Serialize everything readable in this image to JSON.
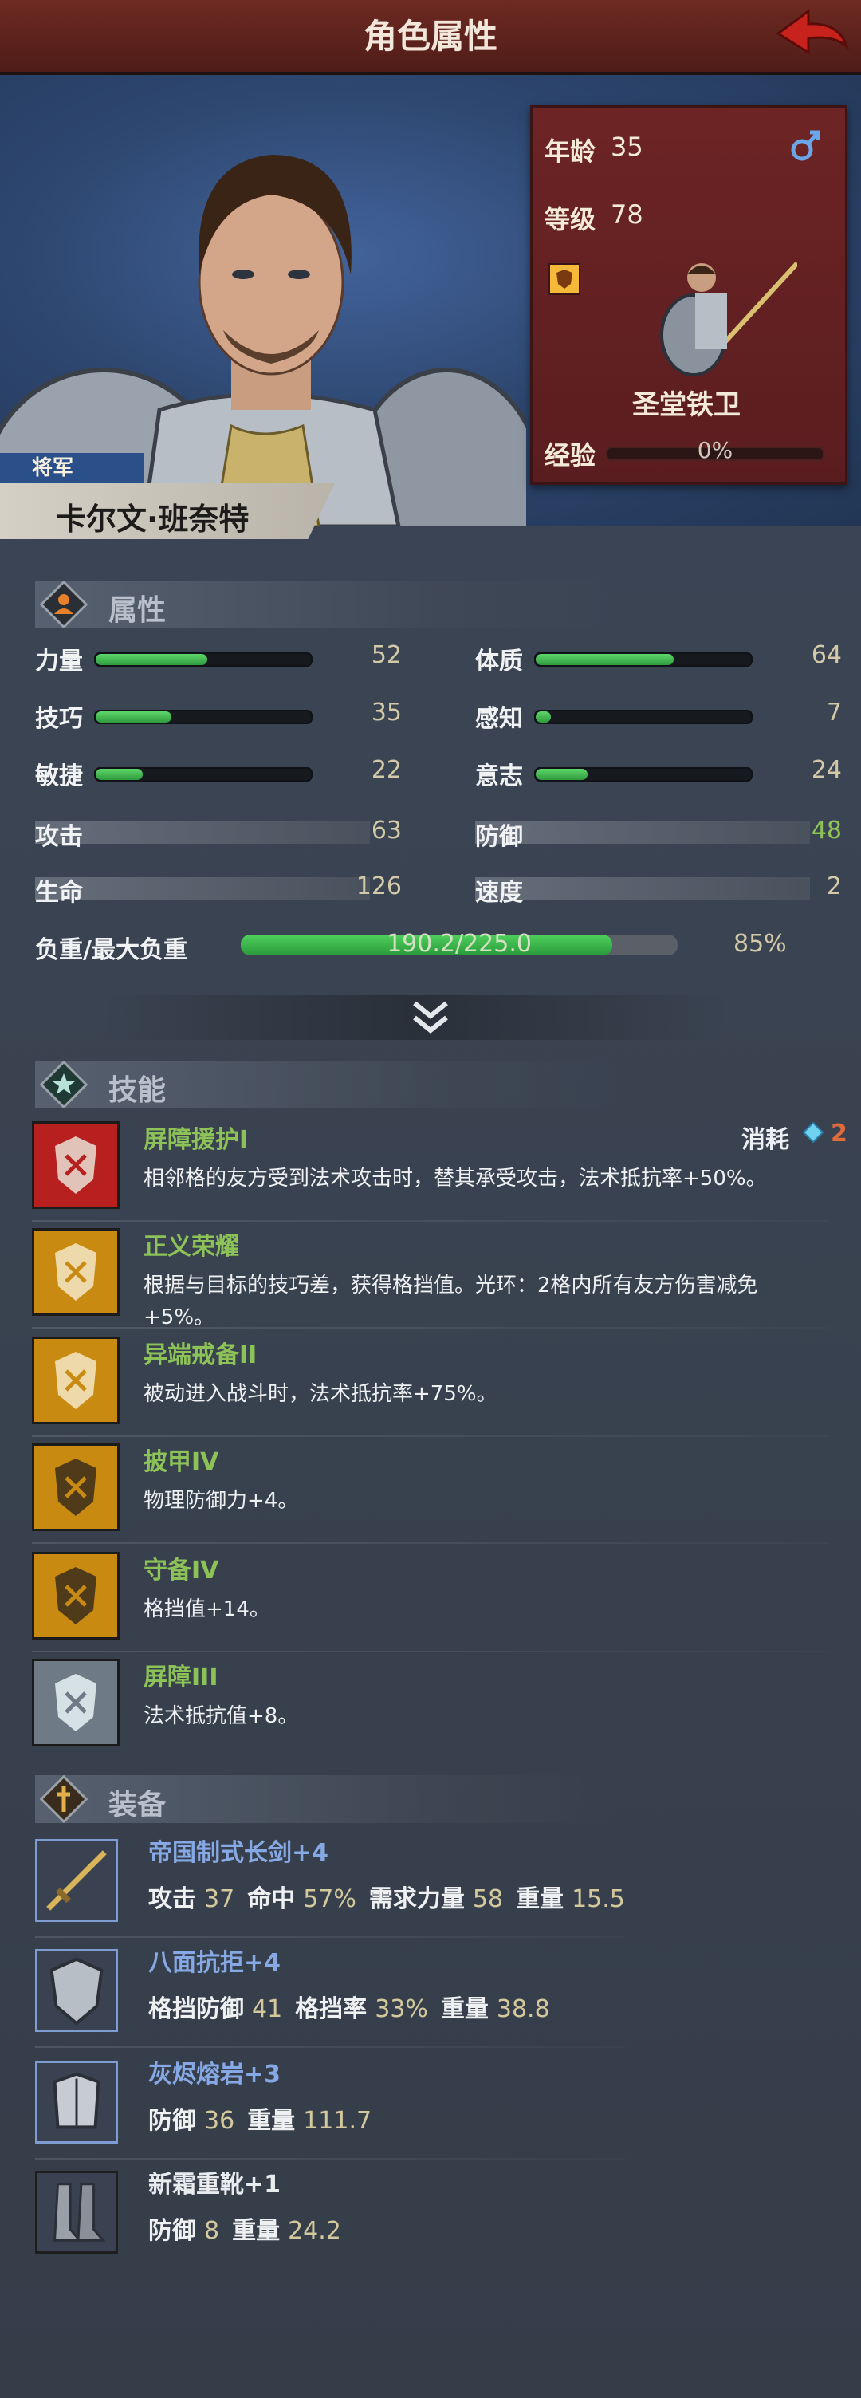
{
  "header": {
    "title": "角色属性"
  },
  "hero": {
    "rank": "将军",
    "name": "卡尔文·班奈特"
  },
  "card": {
    "age_label": "年龄",
    "age_value": "35",
    "level_label": "等级",
    "level_value": "78",
    "class_name": "圣堂铁卫",
    "exp_label": "经验",
    "exp_value": "0%",
    "gender_icon": "male-icon"
  },
  "attributes": {
    "title": "属性",
    "bars": [
      {
        "label": "力量",
        "value": "52",
        "fill": 0.52
      },
      {
        "label": "体质",
        "value": "64",
        "fill": 0.64
      },
      {
        "label": "技巧",
        "value": "35",
        "fill": 0.35
      },
      {
        "label": "感知",
        "value": "7",
        "fill": 0.07
      },
      {
        "label": "敏捷",
        "value": "22",
        "fill": 0.22
      },
      {
        "label": "意志",
        "value": "24",
        "fill": 0.24
      }
    ],
    "plain": [
      {
        "label": "攻击",
        "value": "63"
      },
      {
        "label": "防御",
        "value": "48"
      },
      {
        "label": "生命",
        "value": "126"
      },
      {
        "label": "速度",
        "value": "2"
      }
    ],
    "load_label": "负重/最大负重",
    "load_text": "190.2/225.0",
    "load_fill": 0.85,
    "load_percent": "85%"
  },
  "skills": {
    "title": "技能",
    "cost_label": "消耗",
    "cost_value": "2",
    "items": [
      {
        "name": "屏障援护I",
        "desc": "相邻格的友方受到法术攻击时，替其承受攻击，法术抵抗率+50%。",
        "icon": "shield-guard-icon"
      },
      {
        "name": "正义荣耀",
        "desc": "根据与目标的技巧差，获得格挡值。光环：2格内所有友方伤害减免",
        "desc2": "+5%。",
        "icon": "knight-glory-icon"
      },
      {
        "name": "异端戒备II",
        "desc": "被动进入战斗时，法术抵抗率+75%。",
        "icon": "heresy-guard-icon"
      },
      {
        "name": "披甲IV",
        "desc": "物理防御力+4。",
        "icon": "armor-shield-icon"
      },
      {
        "name": "守备IV",
        "desc": "格挡值+14。",
        "icon": "block-icon"
      },
      {
        "name": "屏障III",
        "desc": "法术抵抗值+8。",
        "icon": "barrier-icon"
      }
    ]
  },
  "equipment": {
    "title": "装备",
    "items": [
      {
        "name": "帝国制式长剑",
        "plus": "+4",
        "icon": "sword-icon",
        "stats": [
          [
            "攻击",
            "37"
          ],
          [
            "命中",
            "57%"
          ],
          [
            "需求力量",
            "58"
          ],
          [
            "重量",
            "15.5"
          ]
        ]
      },
      {
        "name": "八面抗拒",
        "plus": "+4",
        "icon": "kite-shield-icon",
        "stats": [
          [
            "格挡防御",
            "41"
          ],
          [
            "格挡率",
            "33%"
          ],
          [
            "重量",
            "38.8"
          ]
        ]
      },
      {
        "name": "灰烬熔岩",
        "plus": "+3",
        "icon": "plate-armor-icon",
        "stats": [
          [
            "防御",
            "36"
          ],
          [
            "重量",
            "111.7"
          ]
        ]
      },
      {
        "name": "新霜重靴",
        "plus": "+1",
        "icon": "boots-icon",
        "stats": [
          [
            "防御",
            "8"
          ],
          [
            "重量",
            "24.2"
          ]
        ]
      }
    ]
  }
}
